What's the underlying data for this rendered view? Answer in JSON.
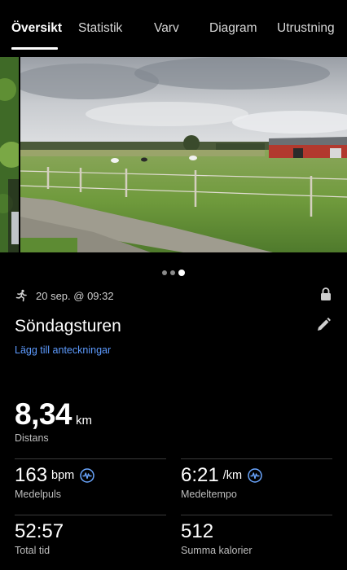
{
  "tabs": [
    {
      "label": "Översikt",
      "active": true
    },
    {
      "label": "Statistik",
      "active": false
    },
    {
      "label": "Varv",
      "active": false
    },
    {
      "label": "Diagram",
      "active": false
    },
    {
      "label": "Utrustning",
      "active": false
    }
  ],
  "carousel": {
    "photo_count": 3,
    "current_index": 3
  },
  "activity": {
    "type_icon": "running-icon",
    "datetime": "20 sep. @ 09:32",
    "privacy_icon": "lock-icon",
    "title": "Söndagsturen",
    "edit_icon": "pencil-icon",
    "add_notes": "Lägg till anteckningar"
  },
  "stats": {
    "distance": {
      "value": "8,34",
      "unit": "km",
      "label": "Distans"
    },
    "avg_hr": {
      "value": "163",
      "unit": "bpm",
      "label": "Medelpuls",
      "icon": "heart-rate-zone-icon"
    },
    "avg_pace": {
      "value": "6:21",
      "unit": "/km",
      "label": "Medeltempo",
      "icon": "pace-zone-icon"
    },
    "total_time": {
      "value": "52:57",
      "label": "Total tid"
    },
    "calories": {
      "value": "512",
      "label": "Summa kalorier"
    }
  },
  "colors": {
    "background": "#000000",
    "link": "#5d9bff",
    "zone_icon": "#6aa6ff"
  }
}
